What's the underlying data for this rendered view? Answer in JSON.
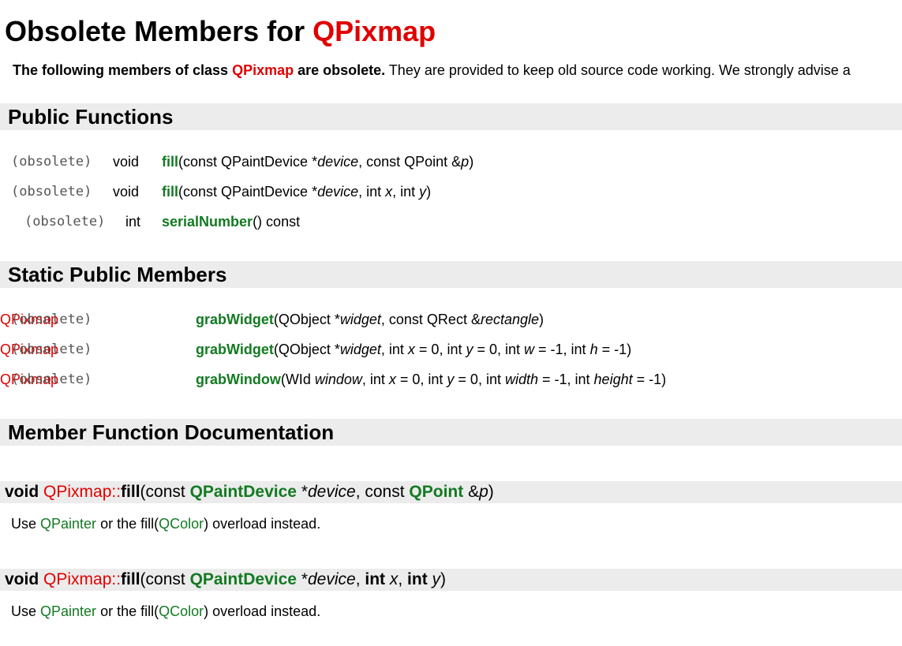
{
  "page": {
    "title_prefix": "Obsolete Members for ",
    "title_class": "QPixmap",
    "intro_bold_1": "The following members of class ",
    "intro_class": "QPixmap",
    "intro_bold_2": " are obsolete.",
    "intro_rest": " They are provided to keep old source code working. We strongly advise a"
  },
  "sections": {
    "public_functions": "Public Functions",
    "static_public_members": "Static Public Members",
    "member_function_documentation": "Member Function Documentation"
  },
  "public_functions": [
    {
      "tag": "(obsolete)",
      "type": "void",
      "name": "fill",
      "args_before": "(const QPaintDevice *",
      "p1": "device",
      "mid1": ", const QPoint &",
      "p2": "p",
      "end": ")"
    },
    {
      "tag": "(obsolete)",
      "type": "void",
      "name": "fill",
      "args_before": "(const QPaintDevice *",
      "p1": "device",
      "mid1": ", int ",
      "p2": "x",
      "mid2": ", int ",
      "p3": "y",
      "end": ")"
    },
    {
      "tag": "(obsolete)",
      "type": "int",
      "name": "serialNumber",
      "end": "() const"
    }
  ],
  "static_members": [
    {
      "tag": "(obsolete)",
      "type": "QPixmap",
      "name": "grabWidget",
      "a": "(QObject *",
      "p1": "widget",
      "b": ", const QRect &",
      "p2": "rectangle",
      "end": ")"
    },
    {
      "tag": "(obsolete)",
      "type": "QPixmap",
      "name": "grabWidget",
      "a": "(QObject *",
      "p1": "widget",
      "b": ", int ",
      "p2": "x",
      "c": " = 0, int ",
      "p3": "y",
      "d": " = 0, int ",
      "p4": "w",
      "e": " = -1, int ",
      "p5": "h",
      "end": " = -1)"
    },
    {
      "tag": "(obsolete)",
      "type": "QPixmap",
      "name": "grabWindow",
      "a": "(WId ",
      "p1": "window",
      "b": ", int ",
      "p2": "x",
      "c": " = 0, int ",
      "p3": "y",
      "d": " = 0, int ",
      "p4": "width",
      "e": " = -1, int ",
      "p5": "height",
      "end": " = -1)"
    }
  ],
  "docs": [
    {
      "ret": "void ",
      "cls": "QPixmap",
      "sep": "::",
      "name": "fill",
      "a": "(const ",
      "t1": "QPaintDevice",
      "b": " *",
      "p1": "device",
      "c": ", const ",
      "t2": "QPoint",
      "d": " &",
      "p2": "p",
      "end": ")",
      "desc_1": "Use ",
      "link_1": "QPainter",
      "desc_2": " or the fill(",
      "link_2": "QColor",
      "desc_3": ") overload instead."
    },
    {
      "ret": "void ",
      "cls": "QPixmap",
      "sep": "::",
      "name": "fill",
      "a": "(const ",
      "t1": "QPaintDevice",
      "b": " *",
      "p1": "device",
      "c": ", ",
      "k1": "int",
      "d": " ",
      "p2": "x",
      "e": ", ",
      "k2": "int",
      "f": " ",
      "p3": "y",
      "end": ")",
      "desc_1": "Use ",
      "link_1": "QPainter",
      "desc_2": " or the fill(",
      "link_2": "QColor",
      "desc_3": ") overload instead."
    }
  ],
  "colors": {
    "class_red": "#e00000",
    "link_green": "#137a22",
    "section_bg": "#ececec",
    "obsolete_gray": "#555555"
  }
}
